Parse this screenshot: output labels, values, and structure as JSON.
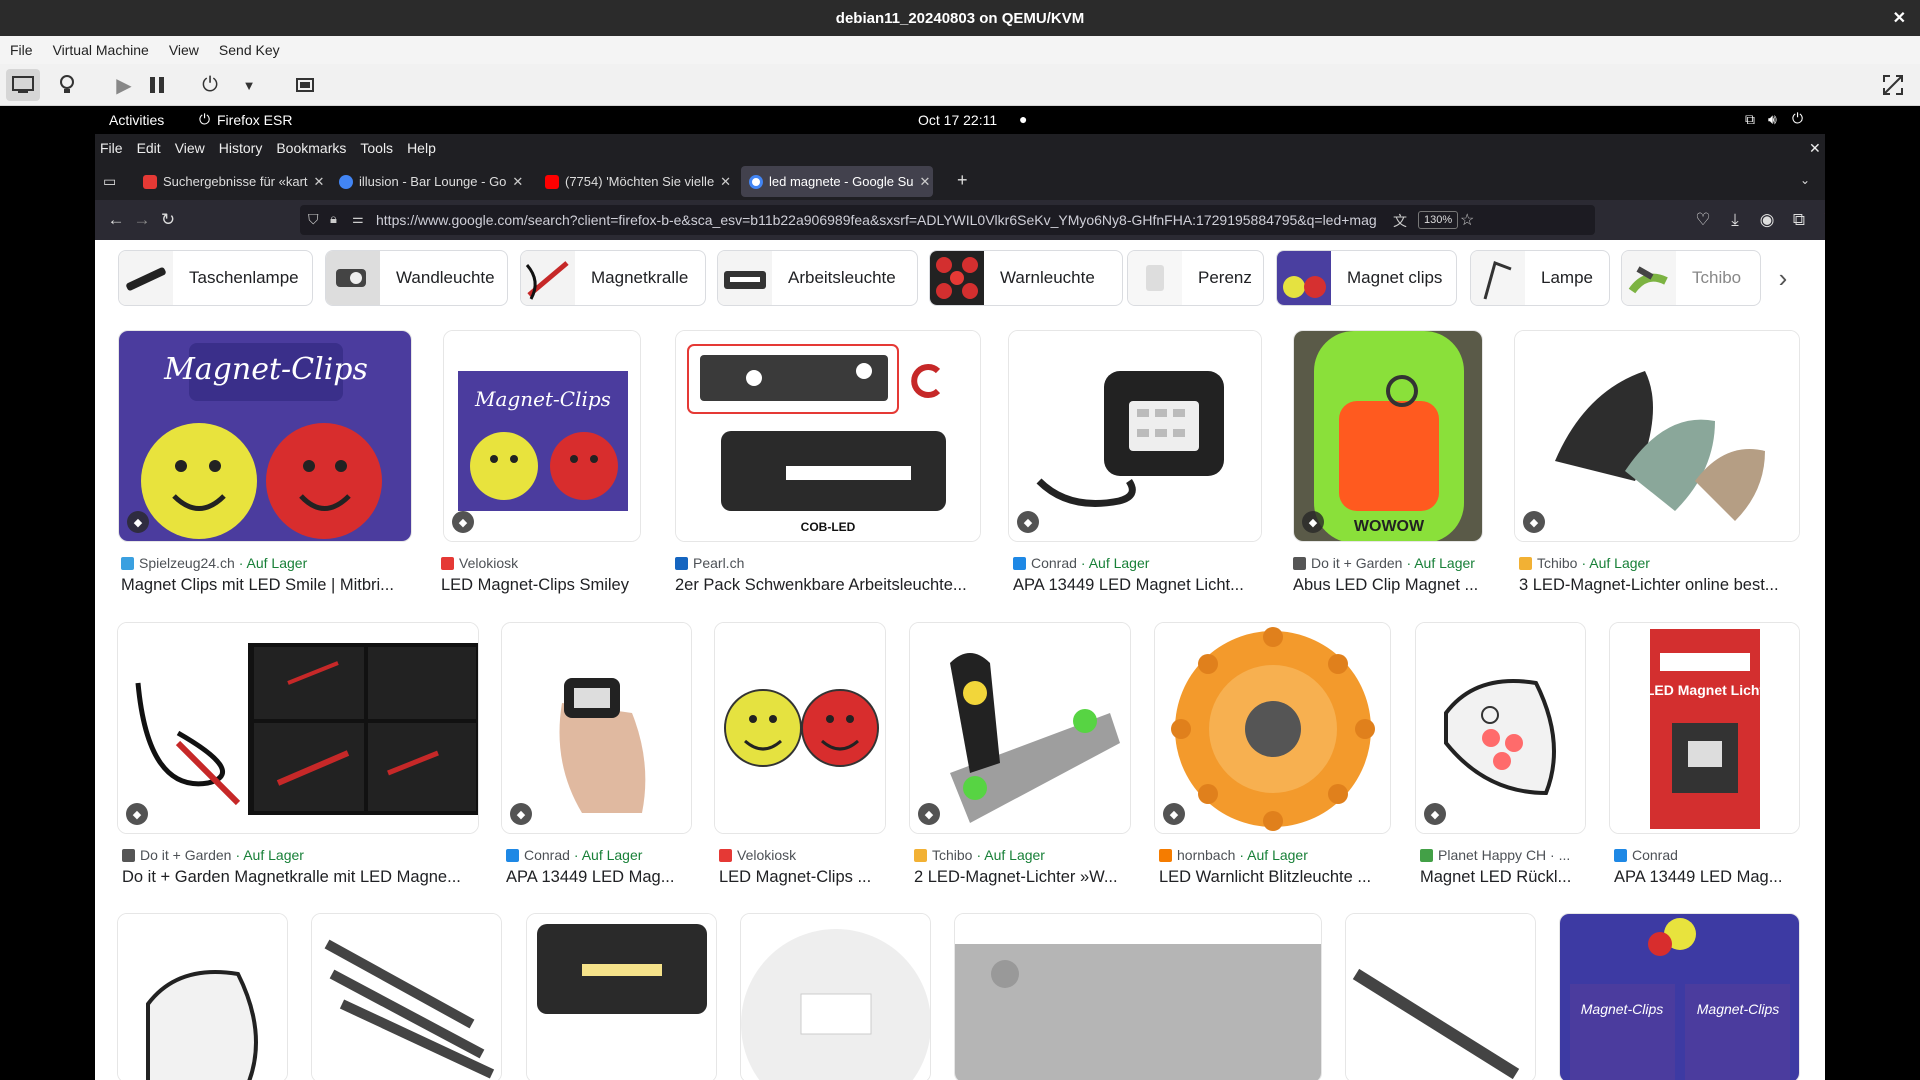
{
  "qemu": {
    "title": "debian11_20240803 on QEMU/KVM",
    "menu": [
      "File",
      "Virtual Machine",
      "View",
      "Send Key"
    ]
  },
  "gnome": {
    "activities": "Activities",
    "app": "Firefox ESR",
    "clock": "Oct 17  22:11"
  },
  "firefox": {
    "menu": [
      "File",
      "Edit",
      "View",
      "History",
      "Bookmarks",
      "Tools",
      "Help"
    ],
    "tabs": [
      {
        "title": "Suchergebnisse für «kart",
        "color": "#e53935"
      },
      {
        "title": "illusion - Bar Lounge - Go",
        "color": "#4285f4"
      },
      {
        "title": "(7754) 'Möchten Sie vielle",
        "color": "#ff0000"
      },
      {
        "title": "led magnete - Google Su",
        "color": "#4285f4"
      }
    ],
    "url": "https://www.google.com/search?client=firefox-b-e&sca_esv=b11b22a906989fea&sxsrf=ADLYWIL0Vlkr6SeKv_YMyo6Ny8-GHfnFHA:1729195884795&q=led+mag",
    "zoom": "130%"
  },
  "chips": [
    "Taschenlampe",
    "Wandleuchte",
    "Magnetkralle",
    "Arbeitsleuchte",
    "Warnleuchte",
    "Perenz",
    "Magnet clips",
    "Lampe",
    "Tchibo"
  ],
  "row1": [
    {
      "source": "Spielzeug24.ch",
      "status": "Auf Lager",
      "title": "Magnet Clips mit LED Smile | Mitbri...",
      "fav": "#3aa0e0"
    },
    {
      "source": "Velokiosk",
      "status": "",
      "title": "LED Magnet-Clips Smiley",
      "fav": "#e53935"
    },
    {
      "source": "Pearl.ch",
      "status": "",
      "title": "2er Pack Schwenkbare Arbeitsleuchte...",
      "fav": "#1565c0"
    },
    {
      "source": "Conrad",
      "status": "Auf Lager",
      "title": "APA 13449 LED Magnet Licht...",
      "fav": "#1e88e5"
    },
    {
      "source": "Do it + Garden",
      "status": "Auf Lager",
      "title": "Abus LED Clip Magnet ...",
      "fav": "#555555"
    },
    {
      "source": "Tchibo",
      "status": "Auf Lager",
      "title": "3 LED-Magnet-Lichter online best...",
      "fav": "#f2b134"
    }
  ],
  "row2": [
    {
      "source": "Do it + Garden",
      "status": "Auf Lager",
      "title": "Do it + Garden Magnetkralle mit LED Magne...",
      "fav": "#555555"
    },
    {
      "source": "Conrad",
      "status": "Auf Lager",
      "title": "APA 13449 LED Mag...",
      "fav": "#1e88e5"
    },
    {
      "source": "Velokiosk",
      "status": "",
      "title": "LED Magnet-Clips ...",
      "fav": "#e53935"
    },
    {
      "source": "Tchibo",
      "status": "Auf Lager",
      "title": "2 LED-Magnet-Lichter »W...",
      "fav": "#f2b134"
    },
    {
      "source": "hornbach",
      "status": "Auf Lager",
      "title": "LED Warnlicht Blitzleuchte ...",
      "fav": "#f57c00"
    },
    {
      "source": "Planet Happy CH · ...",
      "status": "",
      "title": "Magnet LED Rückl...",
      "fav": "#43a047"
    },
    {
      "source": "Conrad",
      "status": "",
      "title": "APA 13449 LED Mag...",
      "fav": "#1e88e5"
    }
  ]
}
